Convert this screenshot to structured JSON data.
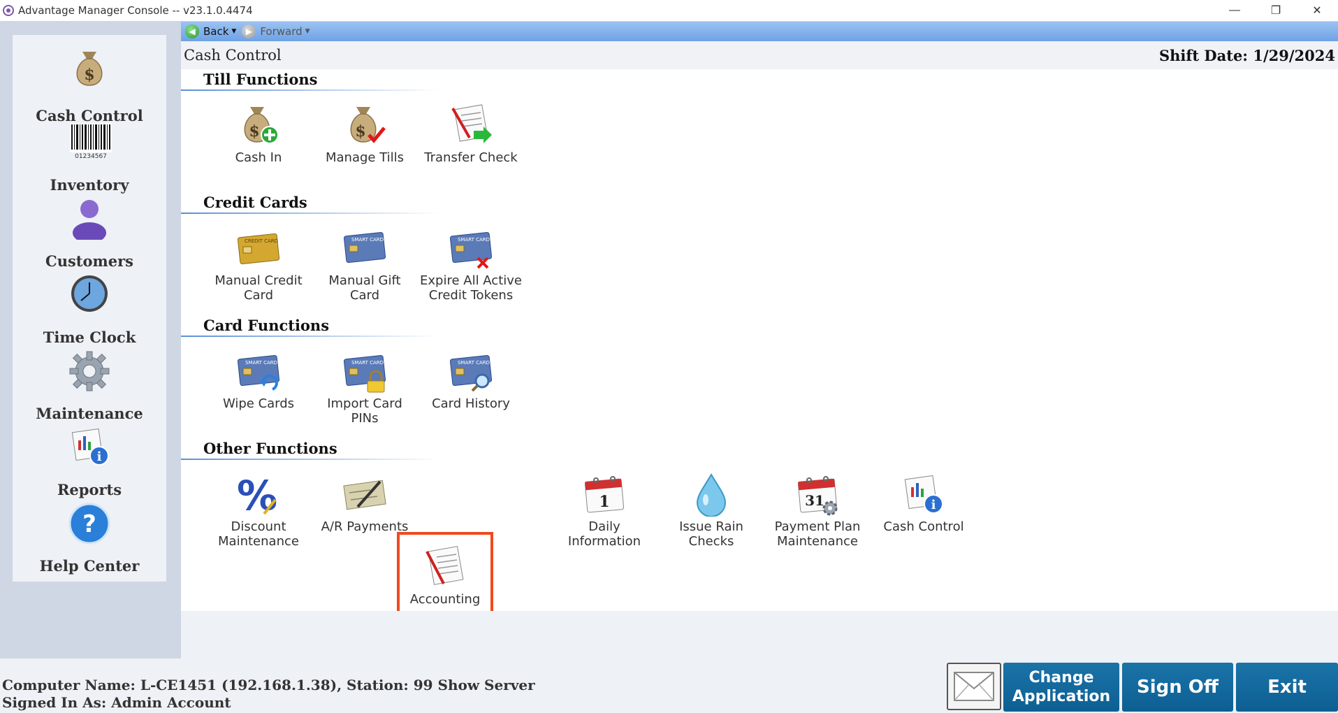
{
  "window": {
    "title": "Advantage Manager Console -- v23.1.0.4474",
    "minimize_icon": "—",
    "restore_icon": "❐",
    "close_icon": "✕"
  },
  "sidebar": {
    "items": [
      {
        "label": "Cash Control",
        "icon": "money-bag-icon"
      },
      {
        "label": "Inventory",
        "icon": "barcode-icon"
      },
      {
        "label": "Customers",
        "icon": "user-icon"
      },
      {
        "label": "Time Clock",
        "icon": "clock-icon"
      },
      {
        "label": "Maintenance",
        "icon": "gear-icon"
      },
      {
        "label": "Reports",
        "icon": "report-icon"
      },
      {
        "label": "Help Center",
        "icon": "help-icon"
      }
    ],
    "barcode_text": "01234567",
    "help_symbol": "?"
  },
  "navbar": {
    "back_label": "Back",
    "forward_label": "Forward"
  },
  "header": {
    "breadcrumb": "Cash Control",
    "shift_date": "Shift Date: 1/29/2024"
  },
  "sections": [
    {
      "title": "Till Functions",
      "items": [
        {
          "label": "Cash In",
          "icon": "money-bag-plus-icon"
        },
        {
          "label": "Manage Tills",
          "icon": "money-bag-check-icon"
        },
        {
          "label": "Transfer Check",
          "icon": "document-arrow-icon"
        }
      ]
    },
    {
      "title": "Credit Cards",
      "items": [
        {
          "label": "Manual Credit Card",
          "line1": "Manual Credit",
          "line2": "Card",
          "icon": "gold-card-icon"
        },
        {
          "label": "Manual Gift Card",
          "line1": "Manual Gift",
          "line2": "Card",
          "icon": "smart-card-icon"
        },
        {
          "label": "Expire All Active Credit Tokens",
          "line1": "Expire All Active",
          "line2": "Credit Tokens",
          "icon": "smart-card-x-icon"
        }
      ]
    },
    {
      "title": "Card Functions",
      "items": [
        {
          "label": "Wipe Cards",
          "icon": "smart-card-refresh-icon"
        },
        {
          "label": "Import Card PINs",
          "line1": "Import Card",
          "line2": "PINs",
          "icon": "smart-card-lock-icon"
        },
        {
          "label": "Card History",
          "icon": "smart-card-search-icon"
        }
      ]
    },
    {
      "title": "Other Functions",
      "items": [
        {
          "label": "Discount Maintenance",
          "line1": "Discount",
          "line2": "Maintenance",
          "icon": "percent-icon"
        },
        {
          "label": "A/R Payments",
          "icon": "check-pen-icon"
        },
        {
          "label": "Accounting",
          "icon": "document-pencil-icon"
        },
        {
          "label": "Daily Information",
          "line1": "Daily",
          "line2": "Information",
          "icon": "calendar-icon"
        },
        {
          "label": "Issue Rain Checks",
          "line1": "Issue Rain",
          "line2": "Checks",
          "icon": "water-drop-icon"
        },
        {
          "label": "Payment Plan Maintenance",
          "line1": "Payment Plan",
          "line2": "Maintenance",
          "icon": "calendar-gear-icon"
        },
        {
          "label": "Cash Control",
          "icon": "report-info-icon"
        }
      ]
    }
  ],
  "selected_item": "Accounting",
  "icon_text": {
    "card": "SMART CARD",
    "gold_card": "CREDIT CARD",
    "cal_1": "1",
    "cal_31": "31",
    "info": "i",
    "percent": "%",
    "money": "$"
  },
  "status": {
    "computer_line": "Computer Name: L-CE1451 (192.168.1.38), Station: 99 Show Server",
    "signed_in_line": "Signed In As: Admin Account"
  },
  "buttons": {
    "change_application_1": "Change",
    "change_application_2": "Application",
    "sign_off": "Sign Off",
    "exit": "Exit"
  },
  "colors": {
    "selection_border": "#f04a1f",
    "button_blue": "#1a73a8",
    "navbar_blue": "#7aabeb"
  }
}
